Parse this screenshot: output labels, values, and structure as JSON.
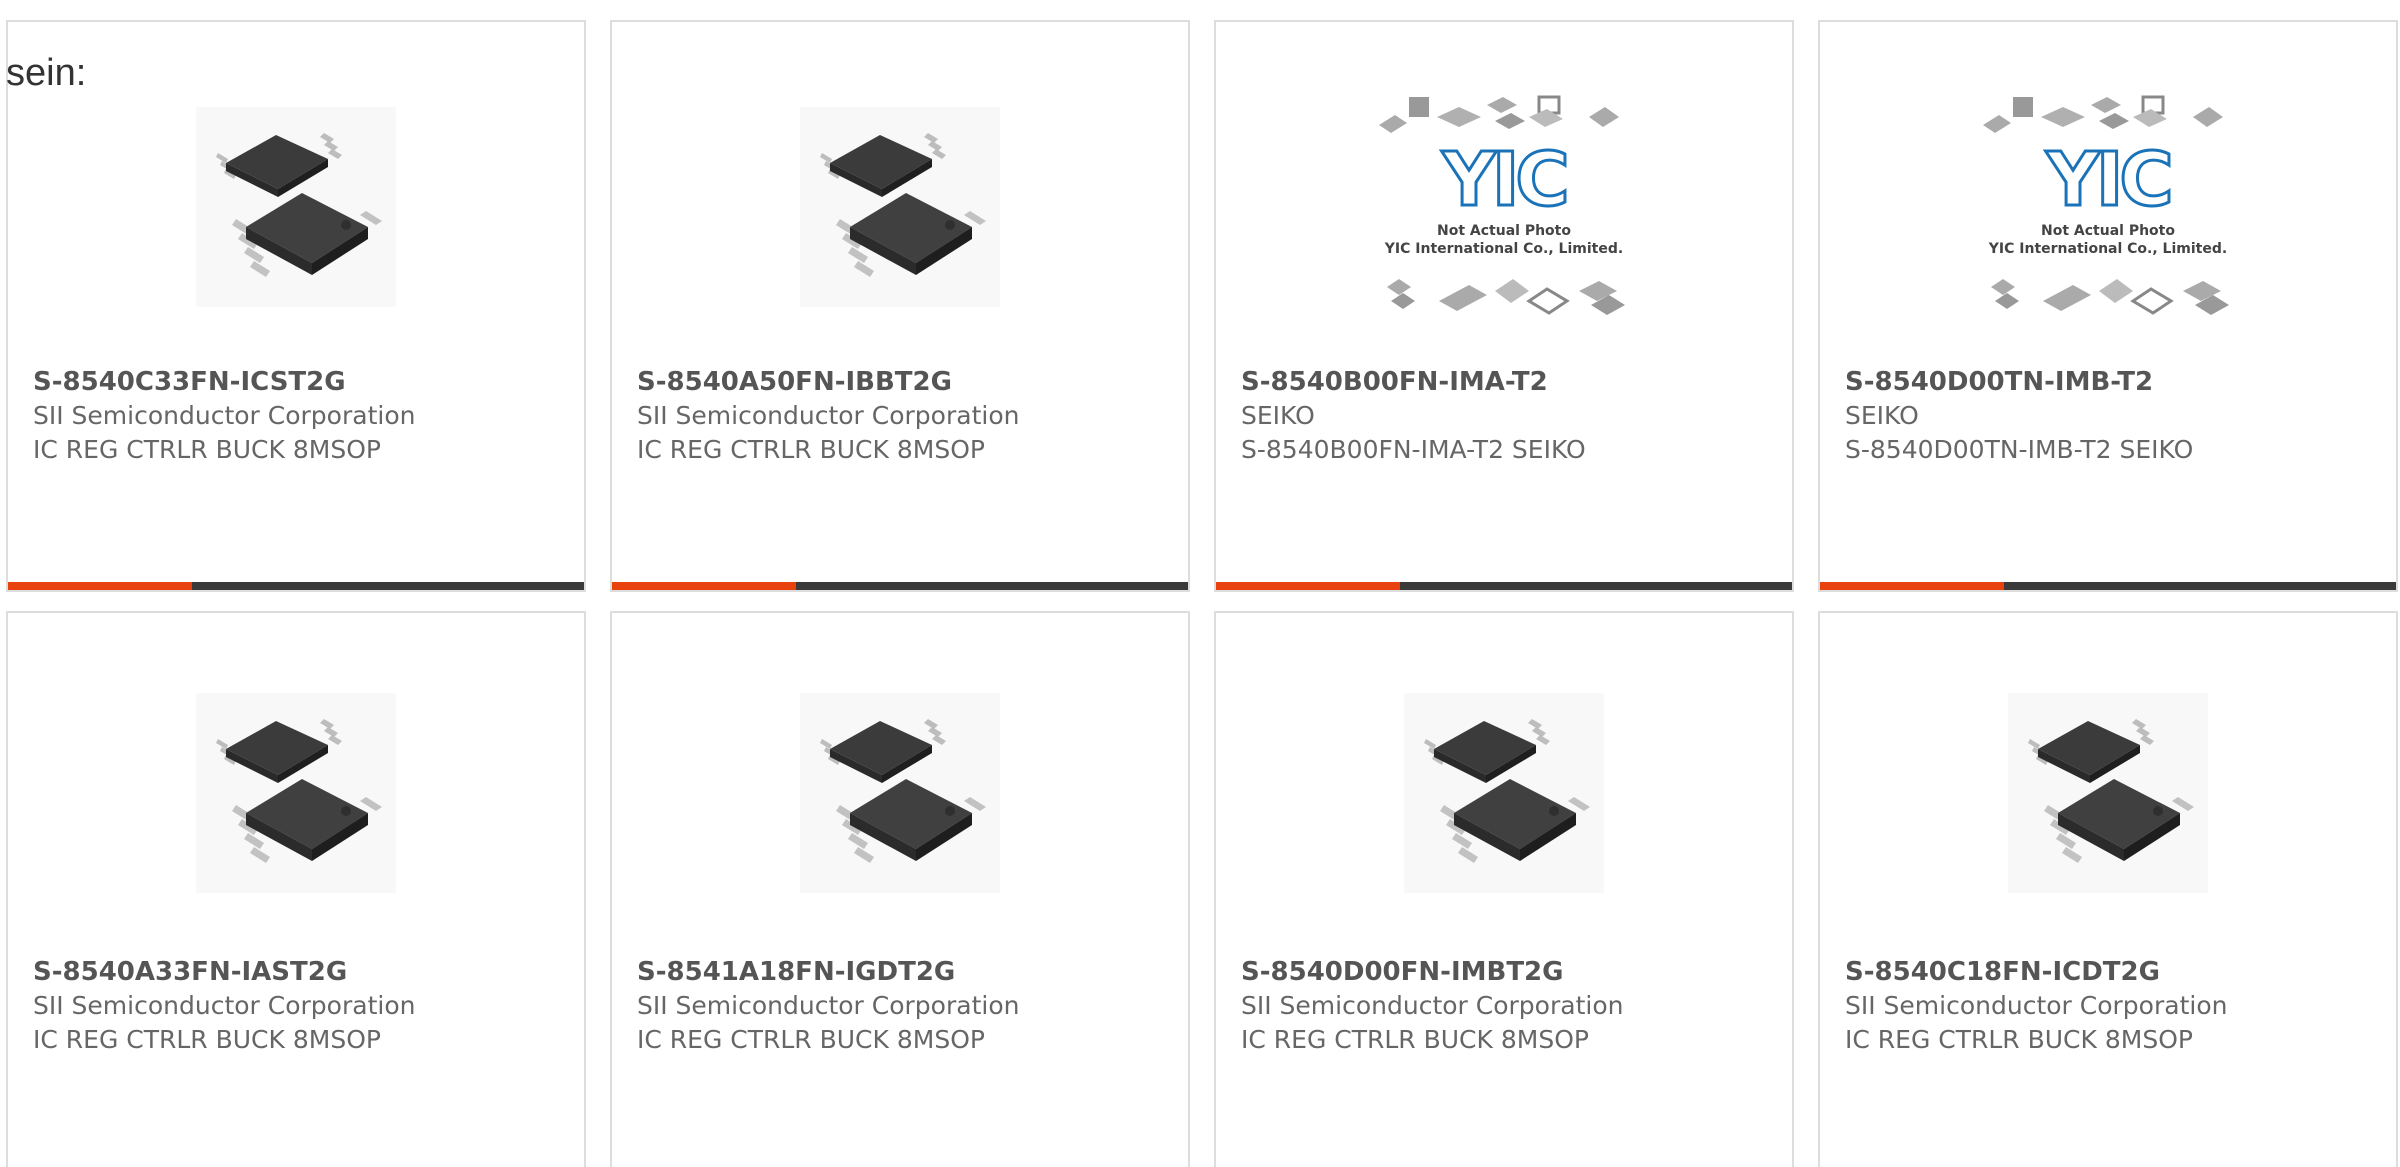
{
  "intro_text": "sein:",
  "colors": {
    "accent": "#e8420e",
    "bar_track": "#3a3a3a",
    "card_border": "#dddddd",
    "text": "#555555"
  },
  "products": [
    {
      "part": "S-8540C33FN-ICST2G",
      "manufacturer": "SII Semiconductor Corporation",
      "description": "IC REG CTRLR BUCK 8MSOP",
      "image": "msop8-chip-icon",
      "progress": 0.32
    },
    {
      "part": "S-8540A50FN-IBBT2G",
      "manufacturer": "SII Semiconductor Corporation",
      "description": "IC REG CTRLR BUCK 8MSOP",
      "image": "msop8-chip-icon",
      "progress": 0.32
    },
    {
      "part": "S-8540B00FN-IMA-T2",
      "manufacturer": "SEIKO",
      "description": "S-8540B00FN-IMA-T2 SEIKO",
      "image": "placeholder-logo",
      "placeholder_lines": [
        "Not Actual Photo",
        "YIC International Co., Limited."
      ],
      "progress": 0.32
    },
    {
      "part": "S-8540D00TN-IMB-T2",
      "manufacturer": "SEIKO",
      "description": "S-8540D00TN-IMB-T2 SEIKO",
      "image": "placeholder-logo",
      "placeholder_lines": [
        "Not Actual Photo",
        "YIC International Co., Limited."
      ],
      "progress": 0.32
    },
    {
      "part": "S-8540A33FN-IAST2G",
      "manufacturer": "SII Semiconductor Corporation",
      "description": "IC REG CTRLR BUCK 8MSOP",
      "image": "msop8-chip-icon"
    },
    {
      "part": "S-8541A18FN-IGDT2G",
      "manufacturer": "SII Semiconductor Corporation",
      "description": "IC REG CTRLR BUCK 8MSOP",
      "image": "msop8-chip-icon"
    },
    {
      "part": "S-8540D00FN-IMBT2G",
      "manufacturer": "SII Semiconductor Corporation",
      "description": "IC REG CTRLR BUCK 8MSOP",
      "image": "msop8-chip-icon"
    },
    {
      "part": "S-8540C18FN-ICDT2G",
      "manufacturer": "SII Semiconductor Corporation",
      "description": "IC REG CTRLR BUCK 8MSOP",
      "image": "msop8-chip-icon"
    }
  ]
}
